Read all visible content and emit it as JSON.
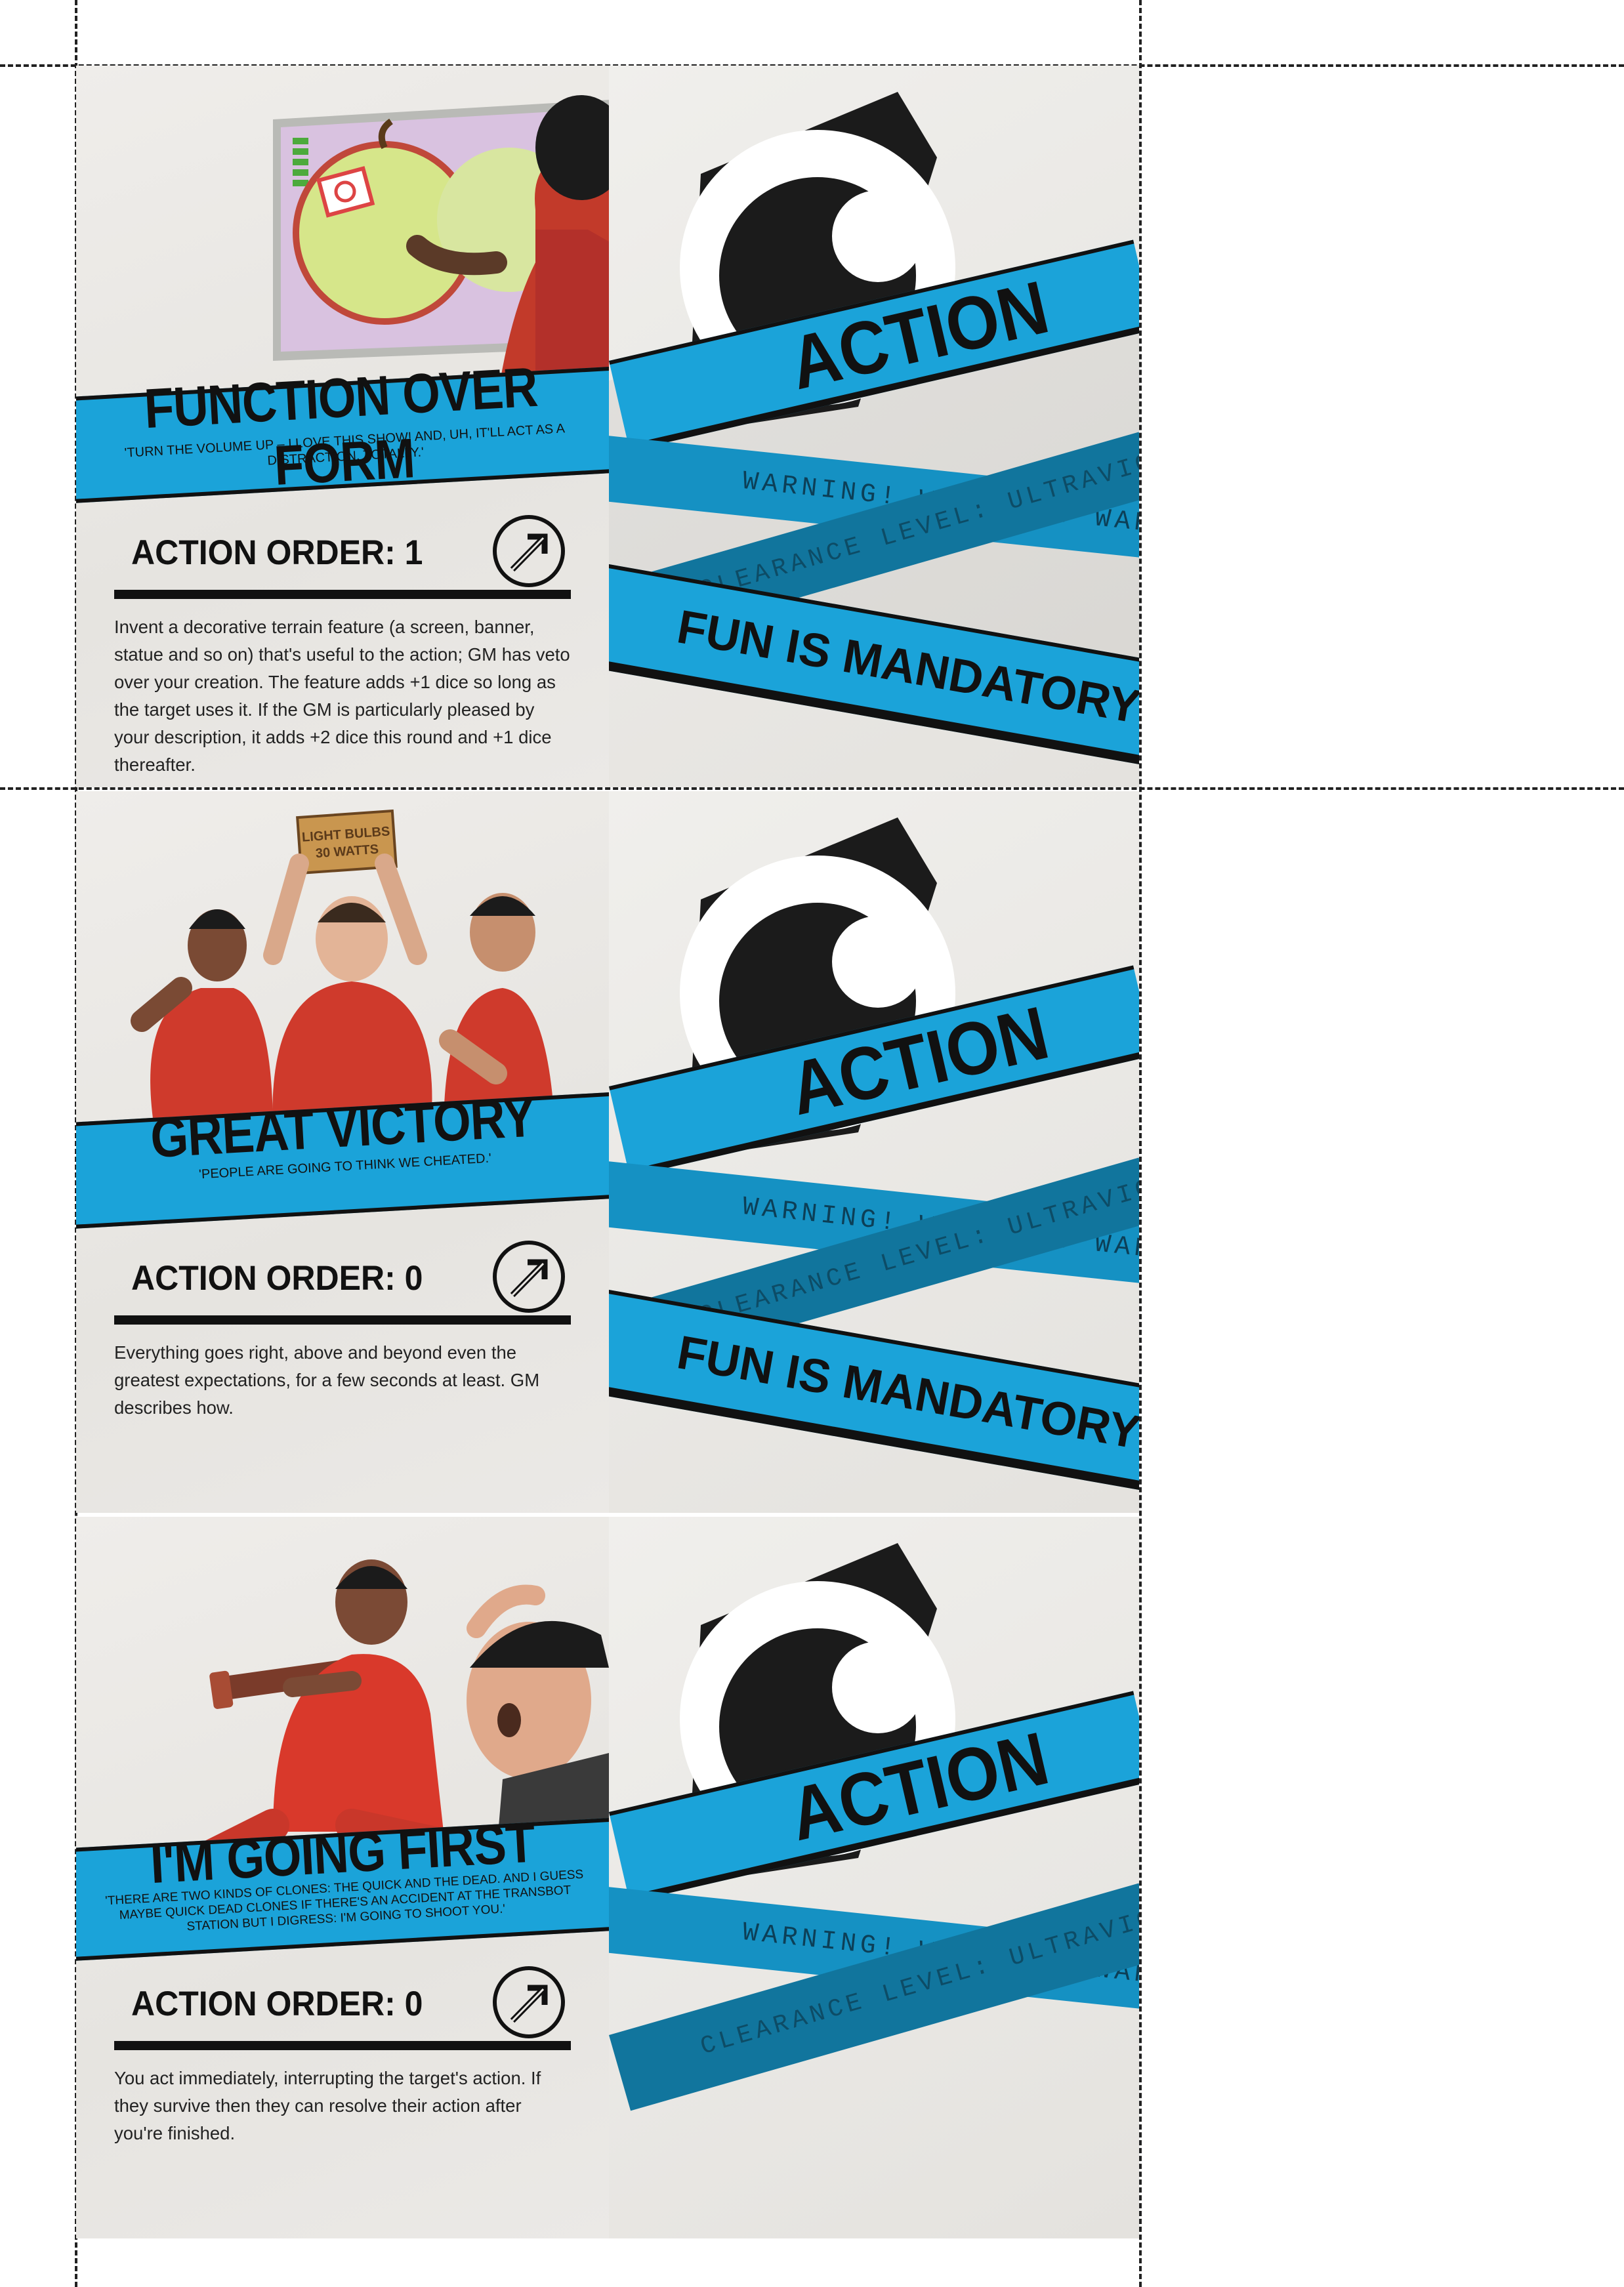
{
  "cards": [
    {
      "title": "FUNCTION OVER FORM",
      "quote": "'TURN THE VOLUME UP – I LOVE THIS SHOW! AND, UH, IT'LL ACT AS A DISTRACTION. TOTALLY.'",
      "order": "ACTION ORDER: 1",
      "body": "Invent a decorative terrain feature (a screen, banner, statue and so on) that's useful to the action; GM has veto over your creation. The feature adds +1 dice so long as the target uses it. If the GM is particularly pleased by your description, it adds +2 dice this round and +1 dice thereafter."
    },
    {
      "title": "GREAT VICTORY",
      "quote": "'PEOPLE ARE GOING TO THINK WE CHEATED.'",
      "order": "ACTION ORDER: 0",
      "body": "Everything goes right, above and beyond even the greatest expectations, for a few seconds at least. GM describes how.",
      "sign": "LIGHT BULBS 30 WATTS"
    },
    {
      "title": "I'M GOING FIRST",
      "quote": "'THERE ARE TWO KINDS OF CLONES: THE QUICK AND THE DEAD. AND I GUESS MAYBE QUICK DEAD CLONES IF THERE'S AN ACCIDENT AT THE TRANSBOT STATION BUT I DIGRESS: I'M GOING TO SHOOT YOU.'",
      "order": "ACTION ORDER: 0",
      "body": "You act immediately, interrupting the target's action. If they survive then they can resolve their action after you're finished."
    }
  ],
  "card_back": {
    "heading": "ACTION",
    "warning": "WARNING! WARNING! WARNING!",
    "clearance": "CLEARANCE LEVEL: ULTRAVIOLET",
    "slogan": "FUN IS MANDATORY!"
  },
  "colors": {
    "accent_blue": "#1ba3d9",
    "dark_blue": "#11759d",
    "ink": "#111111",
    "jumpsuit_red": "#d9392b"
  },
  "icons": {
    "order": "arrow-circle-icon",
    "back": "eye-icon"
  }
}
